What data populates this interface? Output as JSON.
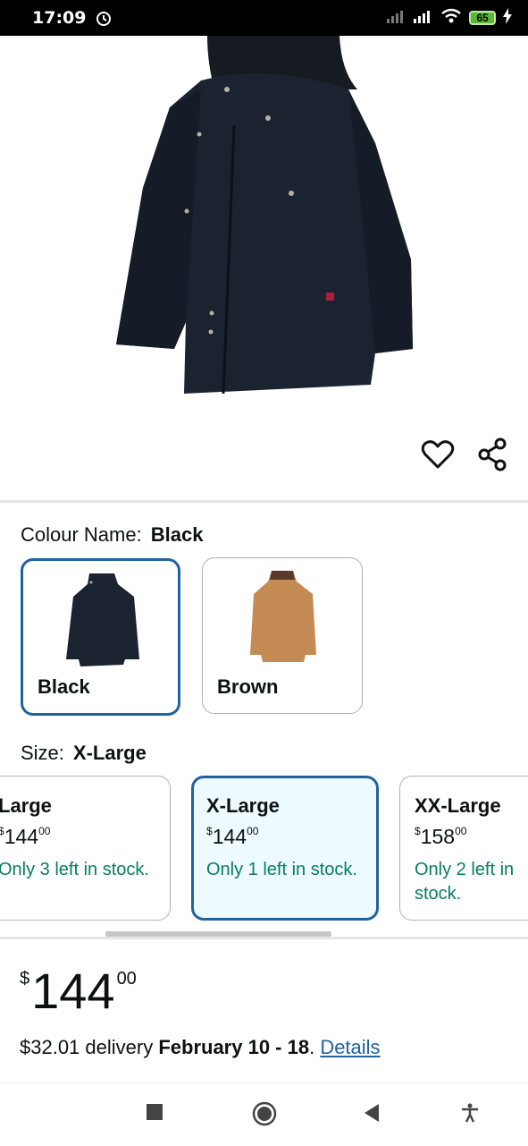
{
  "status": {
    "time": "17:09",
    "battery": "65"
  },
  "colour": {
    "label": "Colour Name:",
    "value": "Black",
    "options": [
      {
        "name": "Black"
      },
      {
        "name": "Brown"
      }
    ]
  },
  "size": {
    "label": "Size:",
    "value": "X-Large",
    "options": [
      {
        "name": "Large",
        "currency": "$",
        "whole": "144",
        "fraction": "00",
        "stock": "Only 3 left in stock."
      },
      {
        "name": "X-Large",
        "currency": "$",
        "whole": "144",
        "fraction": "00",
        "stock": "Only 1 left in stock."
      },
      {
        "name": "XX-Large",
        "currency": "$",
        "whole": "158",
        "fraction": "00",
        "stock": "Only 2 left in stock."
      }
    ]
  },
  "price": {
    "currency": "$",
    "whole": "144",
    "fraction": "00"
  },
  "delivery": {
    "prefix": "$32.01 delivery ",
    "dates": "February 10 - 18",
    "suffix": ". ",
    "link": "Details"
  },
  "colors": {
    "accent": "#2162a1",
    "stock_green": "#067d62",
    "selected_bg": "#edfafe"
  }
}
